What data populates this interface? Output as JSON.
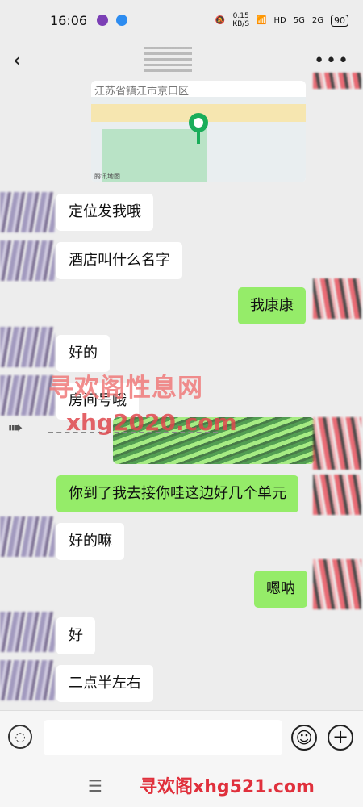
{
  "status_bar": {
    "time": "16:06",
    "net_speed_value": "0.15",
    "net_speed_unit": "KB/S",
    "hd_label": "HD",
    "signal1_label": "5G",
    "signal2_label": "2G",
    "battery": "90"
  },
  "map": {
    "address": "江苏省镇江市京口区",
    "logo": "腾讯地图"
  },
  "messages": [
    {
      "side": "left",
      "text": "定位发我哦"
    },
    {
      "side": "left",
      "text": "酒店叫什么名字"
    },
    {
      "side": "right",
      "text": "我康康"
    },
    {
      "side": "left",
      "text": "好的"
    },
    {
      "side": "left",
      "text": "房间号哦"
    },
    {
      "side": "right",
      "text": "你到了我去接你哇这边好几个单元"
    },
    {
      "side": "left",
      "text": "好的嘛"
    },
    {
      "side": "right",
      "text": "嗯呐"
    },
    {
      "side": "left",
      "text": "好"
    },
    {
      "side": "left",
      "text": "二点半左右"
    }
  ],
  "watermarks": {
    "wm1": "寻欢阁性息网",
    "wm2": "xhg2020.com",
    "wm3": "寻欢阁xhg521.com"
  },
  "icons": {
    "back": "back-arrow-icon",
    "more": "more-icon",
    "voice": "voice-icon",
    "emoji": "emoji-icon",
    "plus": "plus-icon",
    "menu": "menu-icon"
  },
  "colors": {
    "background": "#ededed",
    "bubble_left": "#ffffff",
    "bubble_right": "#95ec69",
    "map_pin": "#1aad5a",
    "watermark_red": "#e0303c"
  }
}
